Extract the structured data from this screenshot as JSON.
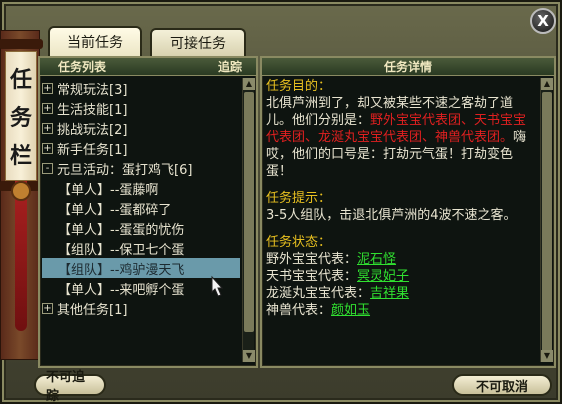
{
  "window": {
    "title_chars": [
      "任",
      "务",
      "栏"
    ],
    "close_label": "X"
  },
  "tabs": [
    {
      "label": "当前任务",
      "active": true
    },
    {
      "label": "可接任务",
      "active": false
    }
  ],
  "task_list": {
    "header_left": "任务列表",
    "header_right": "追踪",
    "rows": [
      {
        "expander": "+",
        "text": "常规玩法[3]",
        "indent": false
      },
      {
        "expander": "+",
        "text": "生活技能[1]",
        "indent": false
      },
      {
        "expander": "+",
        "text": "挑战玩法[2]",
        "indent": false
      },
      {
        "expander": "+",
        "text": "新手任务[1]",
        "indent": false
      },
      {
        "expander": "-",
        "text": "元旦活动：蛋打鸡飞[6]",
        "indent": false
      },
      {
        "expander": "",
        "text": "【单人】--蛋藤啊",
        "indent": true
      },
      {
        "expander": "",
        "text": "【单人】--蛋都碎了",
        "indent": true
      },
      {
        "expander": "",
        "text": "【单人】--蛋蛋的忧伤",
        "indent": true
      },
      {
        "expander": "",
        "text": "【组队】--保卫七个蛋",
        "indent": true
      },
      {
        "expander": "",
        "text": "【组队】--鸡驴漫天飞",
        "indent": true,
        "selected": true
      },
      {
        "expander": "",
        "text": "【单人】--来吧孵个蛋",
        "indent": true
      },
      {
        "expander": "+",
        "text": "其他任务[1]",
        "indent": false
      }
    ]
  },
  "task_detail": {
    "header": "任务详情",
    "goal_title": "任务目的：",
    "goal_text_1": "北俱芦洲到了，却又被某些不速之客劫了道儿。他们分别是：",
    "goal_red": "野外宝宝代表团、天书宝宝代表团、龙涎丸宝宝代表团、神兽代表团。",
    "goal_text_2": "嗨哎，他们的口号是：打劫元气蛋！打劫变色蛋！",
    "hint_title": "任务提示：",
    "hint_text": "3-5人组队，击退北俱芦洲的4波不速之客。",
    "status_title": "任务状态：",
    "status": [
      {
        "label": "野外宝宝代表：",
        "link": "泥石怪"
      },
      {
        "label": "天书宝宝代表：",
        "link": "冥灵妃子"
      },
      {
        "label": "龙涎丸宝宝代表：",
        "link": "吉祥果"
      },
      {
        "label": "神兽代表：",
        "link": "颜如玉"
      }
    ]
  },
  "buttons": {
    "untrack": "不可追踪",
    "cancel": "不可取消"
  },
  "colors": {
    "section_title": "#e8c020",
    "red_text": "#e02020",
    "link_green": "#30e030",
    "selected_row": "#6a9aaa"
  }
}
